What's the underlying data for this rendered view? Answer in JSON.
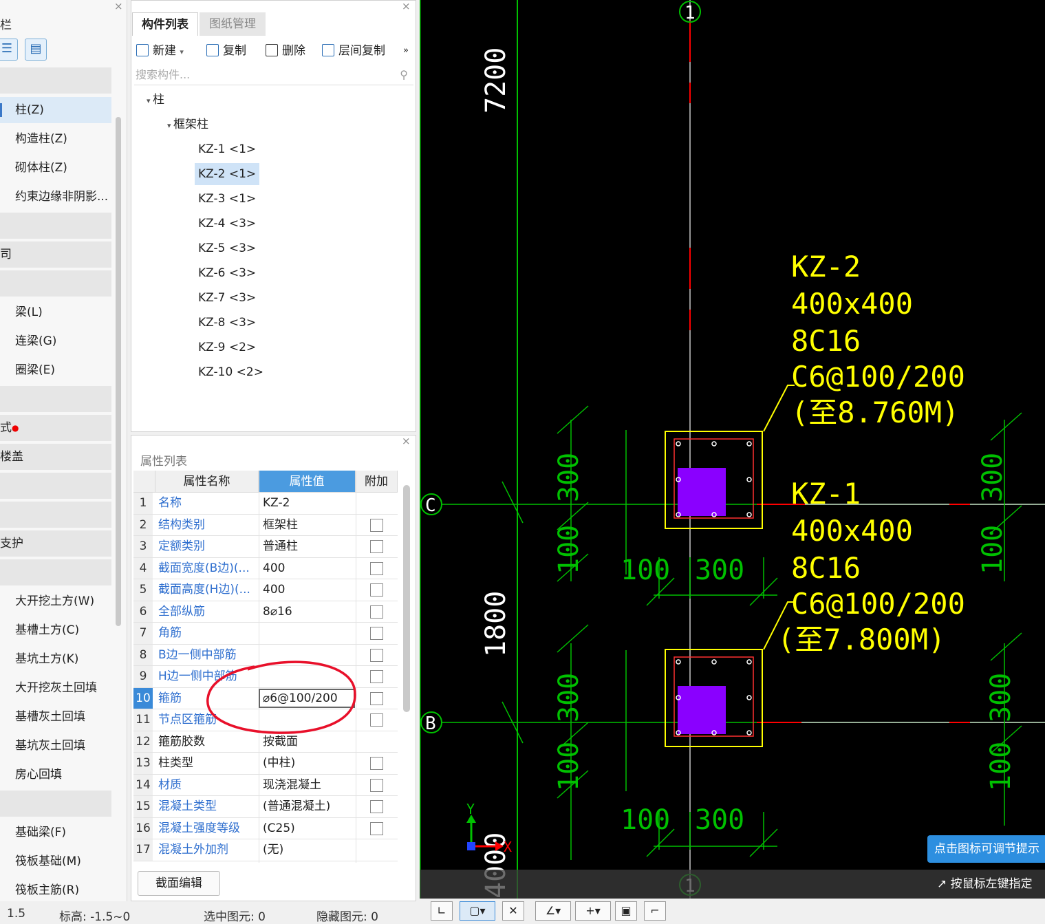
{
  "nav": {
    "close": "×",
    "title": "栏",
    "items": [
      "柱(Z)",
      "构造柱(Z)",
      "砌体柱(Z)",
      "约束边缘非阴影...",
      "司",
      "梁(L)",
      "连梁(G)",
      "圈梁(E)",
      "式",
      "楼盖",
      "支护",
      "大开挖土方(W)",
      "基槽土方(C)",
      "基坑土方(K)",
      "大开挖灰土回填",
      "基槽灰土回填",
      "基坑灰土回填",
      "房心回填",
      "基础梁(F)",
      "筏板基础(M)",
      "筏板主筋(R)"
    ]
  },
  "component_panel": {
    "close": "×",
    "tabs": [
      "构件列表",
      "图纸管理"
    ],
    "toolbar": {
      "new": "新建",
      "copy": "复制",
      "delete": "删除",
      "floor_copy": "层间复制",
      "more": "»"
    },
    "search_placeholder": "搜索构件...",
    "tree_root": "柱",
    "tree_group": "框架柱",
    "tree_items": [
      "KZ-1 <1>",
      "KZ-2 <1>",
      "KZ-3 <1>",
      "KZ-4 <3>",
      "KZ-5 <3>",
      "KZ-6 <3>",
      "KZ-7 <3>",
      "KZ-8 <3>",
      "KZ-9 <2>",
      "KZ-10 <2>"
    ],
    "selected_item": "KZ-2 <1>"
  },
  "property_panel": {
    "close": "×",
    "title": "属性列表",
    "headers": [
      "属性名称",
      "属性值",
      "附加"
    ],
    "rows": [
      {
        "n": "1",
        "name": "名称",
        "value": "KZ-2"
      },
      {
        "n": "2",
        "name": "结构类别",
        "value": "框架柱"
      },
      {
        "n": "3",
        "name": "定额类别",
        "value": "普通柱"
      },
      {
        "n": "4",
        "name": "截面宽度(B边)(...",
        "value": "400"
      },
      {
        "n": "5",
        "name": "截面高度(H边)(...",
        "value": "400"
      },
      {
        "n": "6",
        "name": "全部纵筋",
        "value": "8⌀16"
      },
      {
        "n": "7",
        "name": "角筋",
        "value": ""
      },
      {
        "n": "8",
        "name": "B边一侧中部筋",
        "value": ""
      },
      {
        "n": "9",
        "name": "H边一侧中部筋",
        "value": ""
      },
      {
        "n": "10",
        "name": "箍筋",
        "value": "⌀6@100/200"
      },
      {
        "n": "11",
        "name": "节点区箍筋",
        "value": ""
      },
      {
        "n": "12",
        "name": "箍筋胶数",
        "value": "按截面"
      },
      {
        "n": "13",
        "name": "柱类型",
        "value": "(中柱)"
      },
      {
        "n": "14",
        "name": "材质",
        "value": "现浇混凝土"
      },
      {
        "n": "15",
        "name": "混凝土类型",
        "value": "(普通混凝土)"
      },
      {
        "n": "16",
        "name": "混凝土强度等级",
        "value": "(C25)"
      },
      {
        "n": "17",
        "name": "混凝土外加剂",
        "value": "(无)"
      }
    ],
    "edit_button": "截面编辑"
  },
  "status": {
    "scale": "1.5",
    "elevation": "标高: -1.5~0",
    "selected": "选中图元: 0",
    "hidden": "隐藏图元: 0"
  },
  "cad": {
    "dim_top": "7200",
    "dim_mid": "1800",
    "dim_bottom": "4000",
    "axis_top": "1",
    "axis_bottom": "1",
    "axis_c": "C",
    "axis_b": "B",
    "y_label": "Y",
    "x_label": "X",
    "kz2": {
      "name": "KZ-2",
      "size": "400x400",
      "main_bar": "8C16",
      "stirrup": "C6@100/200",
      "elev": "(至8.760M)"
    },
    "kz1": {
      "name": "KZ-1",
      "size": "400x400",
      "main_bar": "8C16",
      "stirrup": "C6@100/200",
      "elev": "(至7.800M)"
    },
    "dims": {
      "d300": "300",
      "d100": "100"
    },
    "tip": "点击图标可调节提示",
    "tip2": "按鼠标左键指定",
    "colors": {
      "green": "#00c000",
      "yellow": "#ffff00",
      "red": "#ff0000",
      "purple": "#8a00ff",
      "white": "#ffffff"
    }
  }
}
